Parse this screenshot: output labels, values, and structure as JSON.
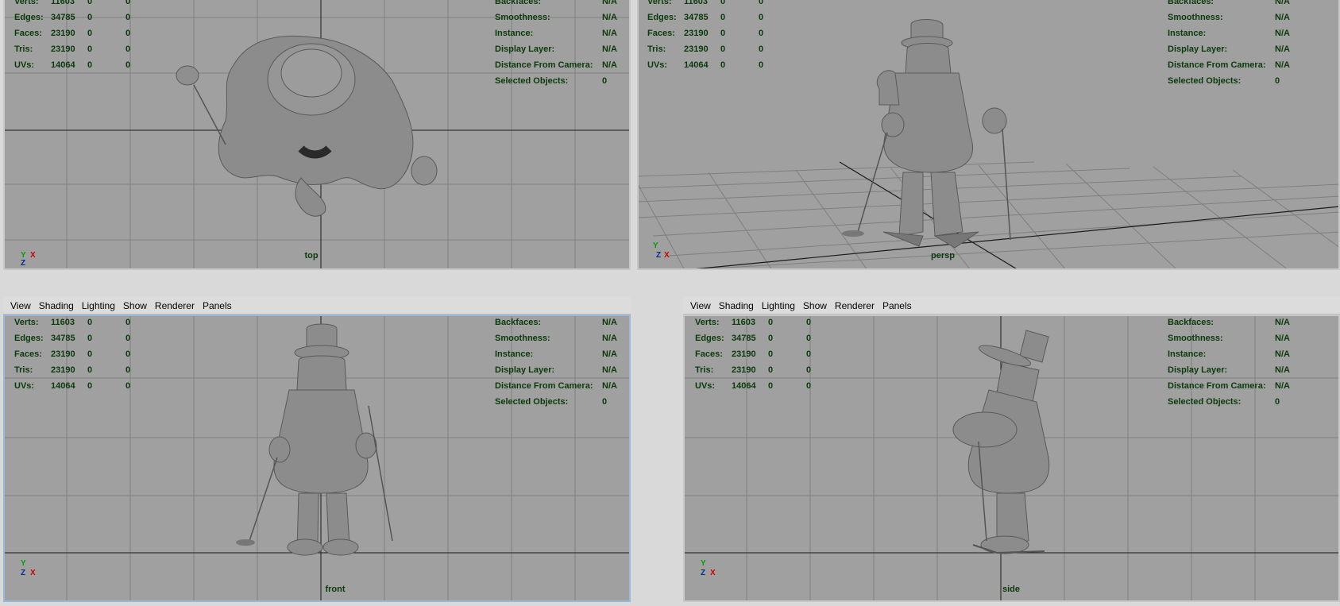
{
  "menu": [
    "View",
    "Shading",
    "Lighting",
    "Show",
    "Renderer",
    "Panels"
  ],
  "stats": [
    {
      "label": "Verts:",
      "v1": "11603",
      "v2": "0",
      "v3": "0"
    },
    {
      "label": "Edges:",
      "v1": "34785",
      "v2": "0",
      "v3": "0"
    },
    {
      "label": "Faces:",
      "v1": "23190",
      "v2": "0",
      "v3": "0"
    },
    {
      "label": "Tris:",
      "v1": "23190",
      "v2": "0",
      "v3": "0"
    },
    {
      "label": "UVs:",
      "v1": "14064",
      "v2": "0",
      "v3": "0"
    }
  ],
  "info": [
    {
      "label": "Backfaces:",
      "value": "N/A"
    },
    {
      "label": "Smoothness:",
      "value": "N/A"
    },
    {
      "label": "Instance:",
      "value": "N/A"
    },
    {
      "label": "Display Layer:",
      "value": "N/A"
    },
    {
      "label": "Distance From Camera:",
      "value": "N/A"
    },
    {
      "label": "Selected Objects:",
      "value": "0"
    }
  ],
  "views": {
    "top": "top",
    "persp": "persp",
    "front": "front",
    "side": "side"
  },
  "axes": {
    "x": "X",
    "y": "Y",
    "z": "Z"
  },
  "colors": {
    "viewport_bg": "#a0a0a0",
    "grid": "#7f7f7f",
    "axis_line": "#1a1a1a",
    "hud_text": "#0b3a0b",
    "model": "#8c8c8c",
    "axis_x": "#d10000",
    "axis_y": "#00a000",
    "axis_z": "#0020d0"
  }
}
